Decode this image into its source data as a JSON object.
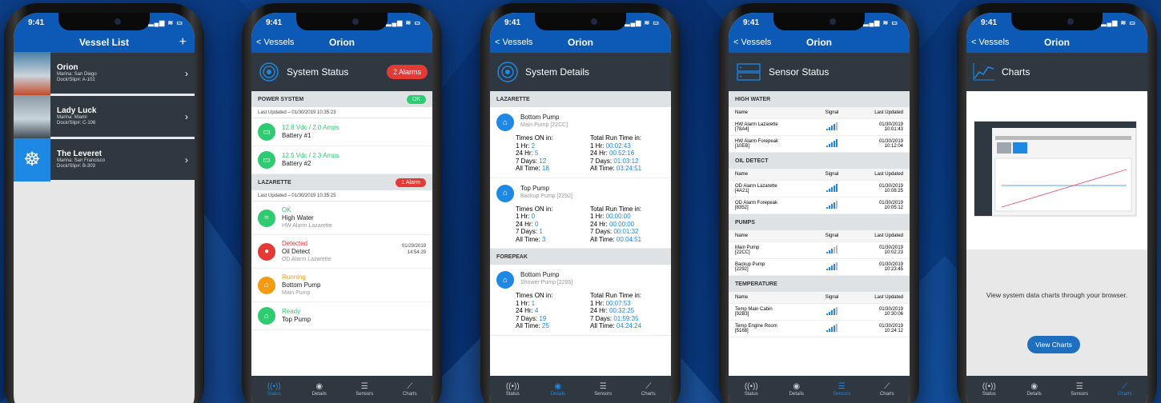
{
  "time": "9:41",
  "colors": {
    "brand": "#0c5ab5",
    "dark": "#2f3740",
    "ok": "#2ecc71",
    "alarm": "#e53935",
    "warn": "#f39c12",
    "link": "#1e88e5"
  },
  "tabs": [
    {
      "label": "Status",
      "icon": "status-icon"
    },
    {
      "label": "Details",
      "icon": "details-icon"
    },
    {
      "label": "Sensors",
      "icon": "sensors-icon"
    },
    {
      "label": "Charts",
      "icon": "charts-icon"
    }
  ],
  "screen1": {
    "title": "Vessel List",
    "add": "+",
    "vessels": [
      {
        "name": "Orion",
        "marina": "Marina: San Diego",
        "slip": "Dock/Slip#: A-102"
      },
      {
        "name": "Lady Luck",
        "marina": "Marina: Miami",
        "slip": "Dock/Slip#: C-106"
      },
      {
        "name": "The Leveret",
        "marina": "Marina: San Francisco",
        "slip": "Dock/Slip#: B-303"
      }
    ]
  },
  "back": "< Vessels",
  "vessel": "Orion",
  "screen2": {
    "header": "System Status",
    "alarms": "2 Alarms",
    "sections": [
      {
        "title": "POWER SYSTEM",
        "badge": "OK",
        "updated": "Last Updated – 01/30/2019  10:35:23"
      },
      {
        "title": "LAZARETTE",
        "badge": "1 Alarm",
        "updated": "Last Updated – 01/30/2019  10:35:25"
      }
    ],
    "battery1": {
      "value": "12.8 Vdc / 2.0 Amps",
      "name": "Battery #1"
    },
    "battery2": {
      "value": "12.5 Vdc / 2.3 Amps",
      "name": "Battery #2"
    },
    "items": [
      {
        "state": "OK",
        "name": "High Water",
        "sub": "HW Alarm Lazarette"
      },
      {
        "state": "Detected",
        "name": "Oil Detect",
        "sub": "OD Alarm Lazarette",
        "date": "01/29/2019",
        "time": "14:54:29"
      },
      {
        "state": "Running",
        "name": "Bottom Pump",
        "sub": "Main Pump"
      },
      {
        "state": "Ready",
        "name": "Top Pump"
      }
    ]
  },
  "screen3": {
    "header": "System Details",
    "sec1": "LAZARETTE",
    "sec2": "FOREPEAK",
    "timesOn": "Times ON in:",
    "totalRun": "Total Run Time in:",
    "pumps": [
      {
        "name": "Bottom Pump",
        "sub": "Main Pump [22CC]",
        "on": {
          "h1": "2",
          "h24": "5",
          "d7": "12",
          "all": "18"
        },
        "run": {
          "h1": "00:02:43",
          "h24": "00:52:16",
          "d7": "01:03:12",
          "all": "03:24:51"
        }
      },
      {
        "name": "Top Pump",
        "sub": "Backup Pump [2292]",
        "on": {
          "h1": "0",
          "h24": "0",
          "d7": "1",
          "all": "3"
        },
        "run": {
          "h1": "00:00:00",
          "h24": "00:00:00",
          "d7": "00:01:32",
          "all": "00:04:51"
        }
      },
      {
        "name": "Bottom Pump",
        "sub": "Shower Pump [2285]",
        "on": {
          "h1": "1",
          "h24": "4",
          "d7": "19",
          "all": "25"
        },
        "run": {
          "h1": "00:07:53",
          "h24": "00:32:25",
          "d7": "01:59:35",
          "all": "04:24:24"
        }
      }
    ],
    "labels": {
      "h1": "1 Hr: ",
      "h24": "24 Hr: ",
      "d7": "7 Days: ",
      "all": "All Time: "
    }
  },
  "screen4": {
    "header": "Sensor Status",
    "cols": {
      "name": "Name",
      "signal": "Signal",
      "updated": "Last Updated"
    },
    "groups": [
      {
        "title": "HIGH WATER",
        "rows": [
          {
            "name": "HW Alarm Lazarette",
            "id": "[78A4]",
            "date": "01/30/2019",
            "time": "10:01:43",
            "sig": 3
          },
          {
            "name": "HW Alarm Forepeak",
            "id": "[10EB]",
            "date": "01/30/2019",
            "time": "10:12:04",
            "sig": 4
          }
        ]
      },
      {
        "title": "OIL DETECT",
        "rows": [
          {
            "name": "OD Alarm Lazarette",
            "id": "[4A21]",
            "date": "01/30/2019",
            "time": "10:08:25",
            "sig": 4
          },
          {
            "name": "OD Alarm Forepeak",
            "id": "[8352]",
            "date": "01/30/2019",
            "time": "10:05:12",
            "sig": 3
          }
        ]
      },
      {
        "title": "PUMPS",
        "rows": [
          {
            "name": "Main Pump",
            "id": "[22CC]",
            "date": "01/30/2019",
            "time": "10:02:23",
            "sig": 2
          },
          {
            "name": "Backup Pump",
            "id": "[2292]",
            "date": "01/30/2019",
            "time": "10:23:45",
            "sig": 3
          }
        ]
      },
      {
        "title": "TEMPERATURE",
        "rows": [
          {
            "name": "Temp Main Cabin",
            "id": "[92B3]",
            "date": "01/30/2019",
            "time": "10:30:06",
            "sig": 3
          },
          {
            "name": "Temp Engine Room",
            "id": "[5168]",
            "date": "01/30/2019",
            "time": "10:24:12",
            "sig": 3
          }
        ]
      }
    ]
  },
  "screen5": {
    "header": "Charts",
    "message": "View system data charts through your browser.",
    "button": "View Charts"
  }
}
